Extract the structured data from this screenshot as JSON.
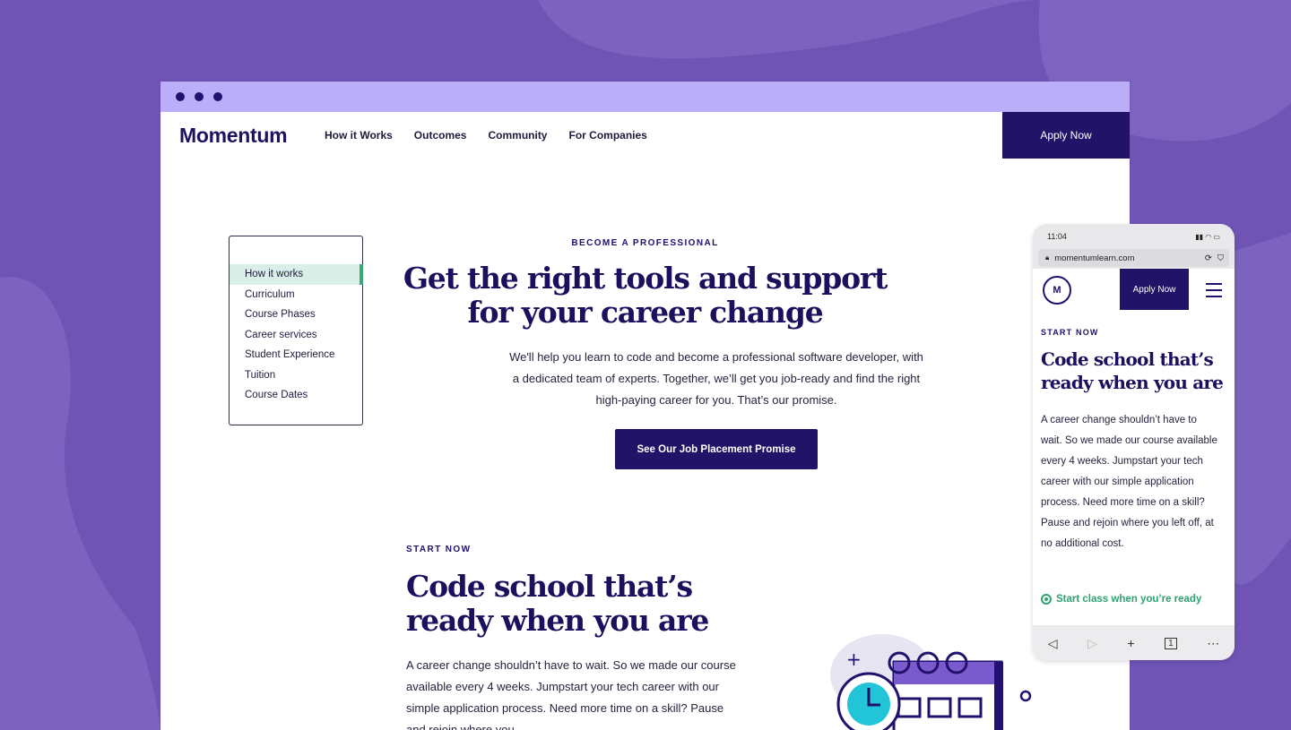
{
  "window": {
    "dots": 3
  },
  "nav": {
    "logo": "Momentum",
    "links": [
      "How it Works",
      "Outcomes",
      "Community",
      "For Companies"
    ],
    "apply": "Apply Now"
  },
  "sidebar": {
    "items": [
      {
        "label": "How it works",
        "active": true
      },
      {
        "label": "Curriculum"
      },
      {
        "label": "Course Phases"
      },
      {
        "label": "Career services"
      },
      {
        "label": "Student Experience"
      },
      {
        "label": "Tuition"
      },
      {
        "label": "Course Dates"
      }
    ]
  },
  "hero": {
    "eyebrow": "BECOME A PROFESSIONAL",
    "title_line1": "Get the right tools and support",
    "title_line2": "for your career change",
    "body_line1": "We'll help you learn to code and become a professional software developer, with",
    "body_line2": "a dedicated team of experts. Together, we’ll get you job-ready and find the right",
    "body_line3": "high-paying career for you. That’s our promise.",
    "cta": "See Our Job Placement Promise"
  },
  "start": {
    "eyebrow": "START NOW",
    "title_line1": "Code school that’s",
    "title_line2": "ready when you are",
    "body_line1": "A career change shouldn’t have to wait. So we made our course",
    "body_line2": "available every 4 weeks. Jumpstart your tech career with our",
    "body_line3": "simple application process. Need more time on a skill? Pause",
    "body_line4": "and rejoin where you"
  },
  "phone": {
    "time": "11:04",
    "url": "momentumlearn.com",
    "apply": "Apply Now",
    "logo_letter": "M",
    "eyebrow": "START NOW",
    "title_line1": "Code school that’s",
    "title_line2": "ready when you are",
    "body": "A career change shouldn’t have to wait. So we made our course available every 4 weeks. Jumpstart your tech career with our simple application process. Need more time on a skill? Pause and rejoin where you left off, at no additional cost.",
    "step": "Start class when you’re ready"
  },
  "colors": {
    "background": "#6f54b6",
    "accent": "#211367",
    "chrome": "#bbaef8",
    "green": "#37a876"
  }
}
